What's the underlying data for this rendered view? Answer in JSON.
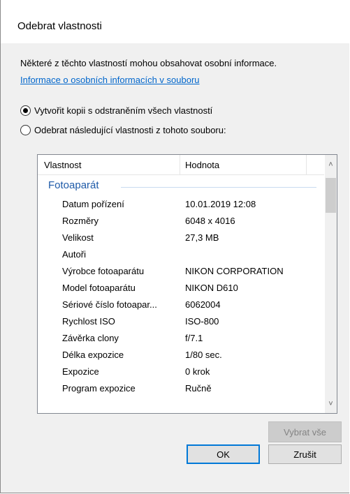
{
  "dialog": {
    "title": "Odebrat vlastnosti",
    "info_text": "Některé z těchto vlastností mohou obsahovat osobní informace.",
    "info_link": "Informace o osobních informacích v souboru",
    "option_copy": "Vytvořit kopii s odstraněním všech vlastností",
    "option_remove": "Odebrat následující vlastnosti z tohoto souboru:"
  },
  "list": {
    "col_property": "Vlastnost",
    "col_value": "Hodnota",
    "group": "Fotoaparát",
    "rows": [
      {
        "name": "Datum pořízení",
        "value": "10.01.2019 12:08"
      },
      {
        "name": "Rozměry",
        "value": "6048 x 4016"
      },
      {
        "name": "Velikost",
        "value": "27,3 MB"
      },
      {
        "name": "Autoři",
        "value": ""
      },
      {
        "name": "Výrobce fotoaparátu",
        "value": "NIKON CORPORATION"
      },
      {
        "name": "Model fotoaparátu",
        "value": "NIKON D610"
      },
      {
        "name": "Sériové číslo fotoapar...",
        "value": "6062004"
      },
      {
        "name": "Rychlost ISO",
        "value": "ISO-800"
      },
      {
        "name": "Závěrka clony",
        "value": "f/7.1"
      },
      {
        "name": "Délka expozice",
        "value": "1/80 sec."
      },
      {
        "name": "Expozice",
        "value": "0 krok"
      },
      {
        "name": "Program expozice",
        "value": "Ručně"
      }
    ]
  },
  "buttons": {
    "select_all": "Vybrat vše",
    "ok": "OK",
    "cancel": "Zrušit"
  }
}
